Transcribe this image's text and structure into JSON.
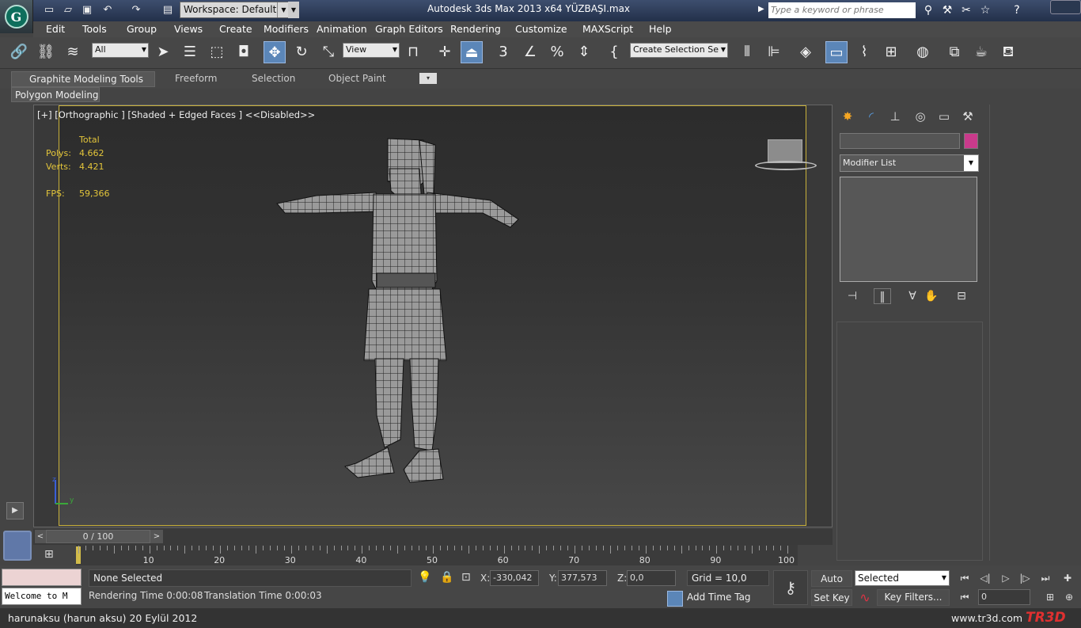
{
  "titlebar": {
    "workspace": "Workspace: Default",
    "title": "Autodesk 3ds Max  2013 x64     YÜZBAŞI.max",
    "search_placeholder": "Type a keyword or phrase"
  },
  "menu": [
    "Edit",
    "Tools",
    "Group",
    "Views",
    "Create",
    "Modifiers",
    "Animation",
    "Graph Editors",
    "Rendering",
    "Customize",
    "MAXScript",
    "Help"
  ],
  "toolbar": {
    "selection_filter": "All",
    "ref_coord": "View",
    "named_selection": "Create Selection Se",
    "snap_label": "3"
  },
  "ribbon": {
    "tabs": [
      "Graphite Modeling Tools",
      "Freeform",
      "Selection",
      "Object Paint"
    ],
    "active_tab": "Graphite Modeling Tools",
    "sub_tab": "Polygon Modeling"
  },
  "viewport": {
    "label": "[+] [Orthographic ] [Shaded + Edged Faces ]  <<Disabled>>",
    "stats": {
      "header": "Total",
      "polys_label": "Polys:",
      "polys_value": "4.662",
      "verts_label": "Verts:",
      "verts_value": "4.421",
      "fps_label": "FPS:",
      "fps_value": "59,366"
    },
    "axis_x": "y",
    "axis_z": "z"
  },
  "command_panel": {
    "modifier_list": "Modifier List",
    "object_color": "#c93a8b"
  },
  "timeline": {
    "slider_text": "0 / 100",
    "ticks": [
      "10",
      "20",
      "30",
      "40",
      "50",
      "60",
      "70",
      "80",
      "90",
      "100"
    ]
  },
  "status": {
    "maxscript_line": "Welcome to M",
    "selection": "None Selected",
    "rendering_time": "Rendering Time  0:00:08",
    "translation_time": "Translation Time  0:00:03",
    "x_label": "X:",
    "x_value": "-330,042",
    "y_label": "Y:",
    "y_value": "377,573",
    "z_label": "Z:",
    "z_value": "0,0",
    "grid": "Grid = 10,0",
    "add_time_tag": "Add Time Tag",
    "auto_key": "Auto Key",
    "set_key": "Set Key",
    "key_mode": "Selected",
    "key_filters": "Key Filters...",
    "frame": "0"
  },
  "footer": {
    "credit": "harunaksu (harun aksu)  20 Eylül 2012",
    "site": "www.tr3d.com",
    "brand": "TR3D"
  }
}
